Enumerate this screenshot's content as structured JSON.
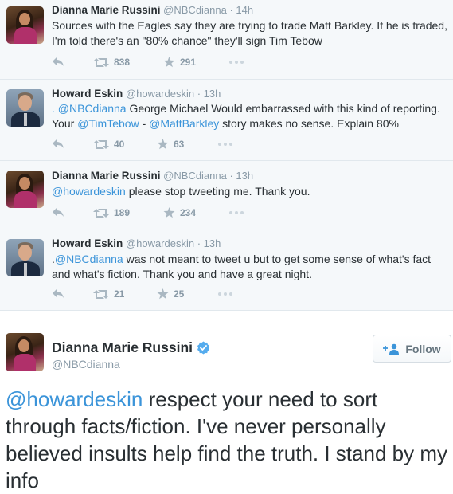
{
  "thread": [
    {
      "name": "Dianna Marie Russini",
      "handle": "@NBCdianna",
      "time": "· 14h",
      "text_parts": [
        "Sources with the Eagles say they are trying to trade Matt Barkley. If he is traded, I'm told there's an \"80% chance\" they'll sign Tim Tebow"
      ],
      "retweets": "838",
      "favorites": "291"
    },
    {
      "name": "Howard Eskin",
      "handle": "@howardeskin",
      "time": "· 13h",
      "mention1": ". @NBCdianna",
      "text_a": " George Michael Would embarrassed with this kind of reporting. Your ",
      "mention2": "@TimTebow",
      "text_b": " - ",
      "mention3": "@MattBarkley",
      "text_c": " story makes no sense. Explain 80%",
      "retweets": "40",
      "favorites": "63"
    },
    {
      "name": "Dianna Marie Russini",
      "handle": "@NBCdianna",
      "time": "· 13h",
      "mention1": "@howardeskin",
      "text_a": " please stop tweeting me. Thank you.",
      "retweets": "189",
      "favorites": "234"
    },
    {
      "name": "Howard Eskin",
      "handle": "@howardeskin",
      "time": "· 13h",
      "text_pre": ".",
      "mention1": "@NBCdianna",
      "text_a": " was not meant to tweet u but to get some sense of what's fact and what's fiction. Thank you and have a great night.",
      "retweets": "21",
      "favorites": "25"
    }
  ],
  "main": {
    "name": "Dianna Marie Russini",
    "handle": "@NBCdianna",
    "follow_label": "Follow",
    "mention": "@howardeskin",
    "text": " respect your need to sort through facts/fiction. I've never personally believed insults help find the truth. I stand by my info"
  },
  "colors": {
    "link": "#3b94d9",
    "muted": "#8899a6",
    "thread_bg": "#f5f8fa",
    "verified": "#55acee"
  },
  "icons": [
    "reply-icon",
    "retweet-icon",
    "favorite-star-icon",
    "more-dots-icon",
    "verified-badge-icon",
    "follow-person-icon"
  ]
}
